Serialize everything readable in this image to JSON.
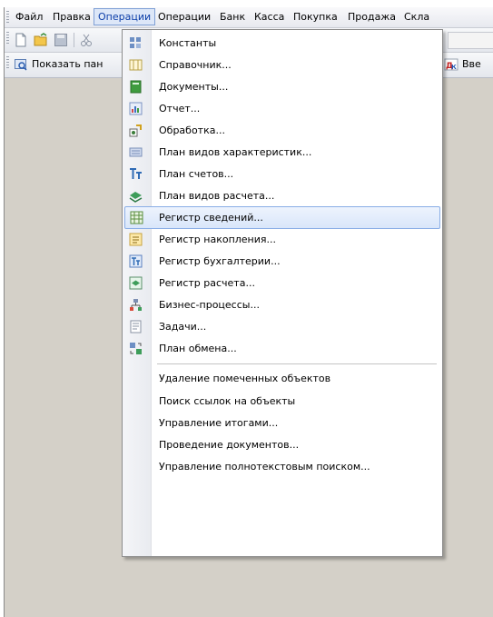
{
  "menubar": {
    "items": [
      "Файл",
      "Правка",
      "Операции",
      "Операции",
      "Банк",
      "Касса",
      "Покупка",
      "Продажа",
      "Скла"
    ]
  },
  "toolbar2": {
    "show_panel_label": "Показать пан",
    "right_label": "Вве"
  },
  "dropdown": {
    "items": [
      {
        "label": "Константы",
        "icon": "constants-icon"
      },
      {
        "label": "Справочник...",
        "icon": "catalog-icon"
      },
      {
        "label": "Документы...",
        "icon": "documents-icon"
      },
      {
        "label": "Отчет...",
        "icon": "report-icon"
      },
      {
        "label": "Обработка...",
        "icon": "data-processor-icon"
      },
      {
        "label": "План видов характеристик...",
        "icon": "characteristic-types-icon"
      },
      {
        "label": "План счетов...",
        "icon": "chart-of-accounts-icon"
      },
      {
        "label": "План видов расчета...",
        "icon": "calculation-types-icon"
      },
      {
        "label": "Регистр сведений...",
        "icon": "information-register-icon"
      },
      {
        "label": "Регистр накопления...",
        "icon": "accumulation-register-icon"
      },
      {
        "label": "Регистр бухгалтерии...",
        "icon": "accounting-register-icon"
      },
      {
        "label": "Регистр расчета...",
        "icon": "calculation-register-icon"
      },
      {
        "label": "Бизнес-процессы...",
        "icon": "business-process-icon"
      },
      {
        "label": "Задачи...",
        "icon": "tasks-icon"
      },
      {
        "label": "План обмена...",
        "icon": "exchange-plan-icon"
      }
    ],
    "service_items": [
      "Удаление помеченных объектов",
      "Поиск ссылок на объекты",
      "Управление итогами...",
      "Проведение документов...",
      "Управление полнотекстовым поиском..."
    ],
    "highlighted_index": 8
  },
  "colors": {
    "accent": "#0b3da8",
    "highlight_border": "#8aaee6",
    "workspace": "#d4d0c8"
  }
}
